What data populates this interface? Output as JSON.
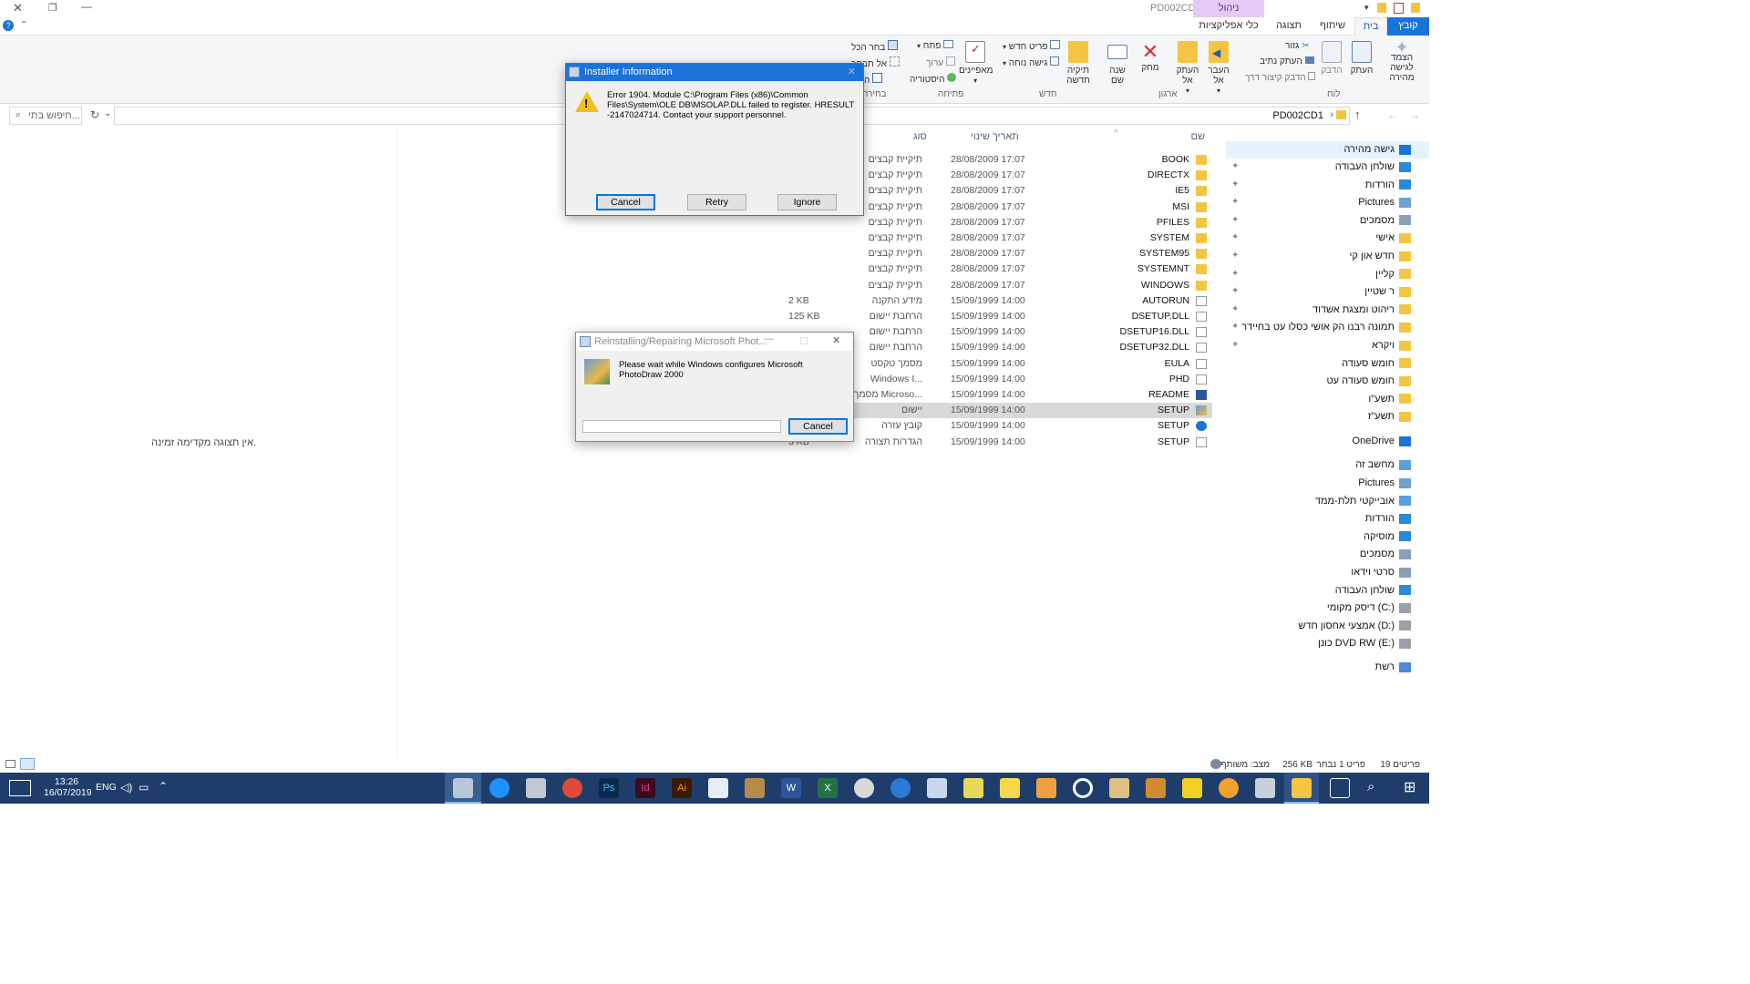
{
  "window": {
    "title": "PD002CD1",
    "context_tab": "ניהול"
  },
  "tabs": [
    "קובץ",
    "בית",
    "שיתוף",
    "תצוגה",
    "כלי אפליקציות"
  ],
  "ribbon": {
    "pin_quick": "הצמד לגישה מהירה",
    "copy": "העתק",
    "paste": "הדבק",
    "cut": "גזור",
    "copy_path": "העתק נתיב",
    "paste_shortcut": "הדבק קיצור דרך",
    "move_to": "העבר אל",
    "copy_to": "העתק אל",
    "delete": "מחק",
    "rename": "שנה שם",
    "new_folder": "תיקיה חדשה",
    "new_item": "פריט חדש",
    "easy_access": "גישה נוחה",
    "properties": "מאפיינים",
    "open": "פתח",
    "edit": "ערוך",
    "history": "היסטוריה",
    "select_all": "בחר הכל",
    "select_none": "אל תבחר",
    "invert": "הפוך",
    "groups": {
      "clipboard": "לוח",
      "organize": "ארגון",
      "new": "חדש",
      "open": "פתיחה",
      "select": "בחירה"
    }
  },
  "address": {
    "path": "PD002CD1",
    "search_placeholder": "חיפוש בתי..."
  },
  "preview_text": "אין תצוגה מקדימה זמינה.",
  "nav": {
    "quick_access": "גישה מהירה",
    "pinned": [
      "שולחן העבודה",
      "הורדות",
      "Pictures",
      "מסמכים",
      "אישי",
      "חדש און קי",
      "קליין",
      "ר שטיין",
      "ריהוט ומצגת אשדוד",
      "תמונה רבנו הק אושי כסלו עט בחיידר",
      "ויקרא"
    ],
    "recent": [
      "חומש סעודה",
      "חומש סעודה עט",
      "תשע\"ו",
      "תשע\"ז"
    ],
    "onedrive": "OneDrive",
    "this_pc": "מחשב זה",
    "pc_items": [
      "Pictures",
      "אובייקטי תלת-ממד",
      "הורדות",
      "מוסיקה",
      "מסמכים",
      "סרטי וידאו",
      "שולחן העבודה",
      "דיסק מקומי (C:)",
      "אמצעי אחסון חדש (D:)",
      "כונן DVD RW (E:)"
    ],
    "network": "רשת"
  },
  "columns": {
    "name": "שם",
    "date": "תאריך שינוי",
    "type": "סוג"
  },
  "files": [
    {
      "name": "BOOK",
      "date": "28/08/2009 17:07",
      "type": "תיקיית קבצים",
      "size": "",
      "kind": "folder"
    },
    {
      "name": "DIRECTX",
      "date": "28/08/2009 17:07",
      "type": "תיקיית קבצים",
      "size": "",
      "kind": "folder"
    },
    {
      "name": "IE5",
      "date": "28/08/2009 17:07",
      "type": "תיקיית קבצים",
      "size": "",
      "kind": "folder"
    },
    {
      "name": "MSI",
      "date": "28/08/2009 17:07",
      "type": "תיקיית קבצים",
      "size": "",
      "kind": "folder"
    },
    {
      "name": "PFILES",
      "date": "28/08/2009 17:07",
      "type": "תיקיית קבצים",
      "size": "",
      "kind": "folder"
    },
    {
      "name": "SYSTEM",
      "date": "28/08/2009 17:07",
      "type": "תיקיית קבצים",
      "size": "",
      "kind": "folder"
    },
    {
      "name": "SYSTEM95",
      "date": "28/08/2009 17:07",
      "type": "תיקיית קבצים",
      "size": "",
      "kind": "folder"
    },
    {
      "name": "SYSTEMNT",
      "date": "28/08/2009 17:07",
      "type": "תיקיית קבצים",
      "size": "",
      "kind": "folder"
    },
    {
      "name": "WINDOWS",
      "date": "28/08/2009 17:07",
      "type": "תיקיית קבצים",
      "size": "",
      "kind": "folder"
    },
    {
      "name": "AUTORUN",
      "date": "15/09/1999 14:00",
      "type": "מידע התקנה",
      "size": "2 KB",
      "kind": "file"
    },
    {
      "name": "DSETUP.DLL",
      "date": "15/09/1999 14:00",
      "type": "הרחבת יישום",
      "size": "125 KB",
      "kind": "file"
    },
    {
      "name": "DSETUP16.DLL",
      "date": "15/09/1999 14:00",
      "type": "הרחבת יישום",
      "size": "",
      "kind": "file"
    },
    {
      "name": "DSETUP32.DLL",
      "date": "15/09/1999 14:00",
      "type": "הרחבת יישום",
      "size": "",
      "kind": "file"
    },
    {
      "name": "EULA",
      "date": "15/09/1999 14:00",
      "type": "מסמך טקסט",
      "size": "",
      "kind": "file"
    },
    {
      "name": "PHD",
      "date": "15/09/1999 14:00",
      "type": "Windows I...",
      "size": "",
      "kind": "file"
    },
    {
      "name": "README",
      "date": "15/09/1999 14:00",
      "type": "מסמך Microso...",
      "size": "",
      "kind": "word"
    },
    {
      "name": "SETUP",
      "date": "15/09/1999 14:00",
      "type": "יישום",
      "size": "",
      "kind": "setup"
    },
    {
      "name": "SETUP",
      "date": "15/09/1999 14:00",
      "type": "קובץ עזרה",
      "size": "",
      "kind": "help"
    },
    {
      "name": "SETUP",
      "date": "15/09/1999 14:00",
      "type": "הגדרות תצורה",
      "size": "3 KB",
      "kind": "file"
    }
  ],
  "dialog_error": {
    "title": "Installer Information",
    "message": "Error 1904. Module C:\\Program Files (x86)\\Common Files\\System\\OLE DB\\MSOLAP.DLL failed to register.  HRESULT -2147024714.  Contact your support personnel.",
    "cancel": "Cancel",
    "retry": "Retry",
    "ignore": "Ignore"
  },
  "dialog_progress": {
    "title": "Reinstalling/Repairing Microsoft Phot...",
    "message": "Please wait while Windows configures Microsoft PhotoDraw 2000",
    "cancel": "Cancel"
  },
  "status": {
    "count": "19 פריטים",
    "selected": "פריט 1 נבחר",
    "size": "256 KB",
    "state": "מצב: משותף"
  },
  "taskbar": {
    "time": "13:26",
    "date": "16/07/2019",
    "lang": "ENG"
  },
  "colors": {
    "accent": "#1a73d9",
    "taskbar": "#1f3d6b",
    "folder": "#f4c542",
    "selected_row": "#d9d9d9"
  }
}
